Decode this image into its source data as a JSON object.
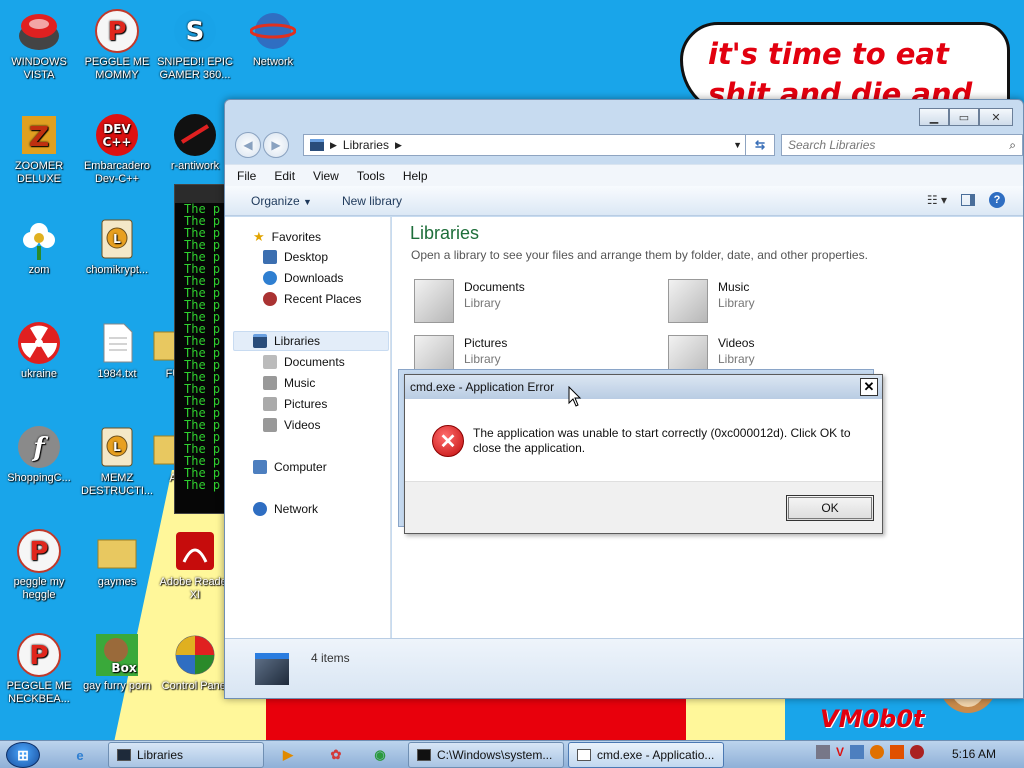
{
  "wallpaper": {
    "bubble_text": "it's time to eat shit and die and chew",
    "signature": "VM0b0t",
    "colors": {
      "sky": "#19a5ea",
      "paper": "#fff79a",
      "red": "#e8000c"
    }
  },
  "desktop_icons": [
    {
      "label": "WINDOWS VISTA",
      "icon": "orb-icon"
    },
    {
      "label": "PEGGLE ME MOMMY",
      "icon": "peggle-icon"
    },
    {
      "label": "SNIPED!! EPIC GAMER 360...",
      "icon": "skype-icon"
    },
    {
      "label": "Network",
      "icon": "network-icon"
    },
    {
      "label": "ZOOMER DELUXE",
      "icon": "zoomer-icon"
    },
    {
      "label": "Embarcadero Dev-C++",
      "icon": "devcpp-icon"
    },
    {
      "label": "r-antiwork",
      "icon": "reddit-icon"
    },
    {
      "label": "zom",
      "icon": "flower-icon"
    },
    {
      "label": "chomikrypt...",
      "icon": "lock-icon"
    },
    {
      "label": "ukraine",
      "icon": "radiation-icon"
    },
    {
      "label": "1984.txt",
      "icon": "text-file-icon"
    },
    {
      "label": "FU",
      "icon": "folder-icon"
    },
    {
      "label": "ShoppingC...",
      "icon": "flash-icon"
    },
    {
      "label": "MEMZ DESTRUCTI...",
      "icon": "lock-icon"
    },
    {
      "label": "A",
      "icon": "folder-icon"
    },
    {
      "label": "peggle my heggle",
      "icon": "peggle-icon"
    },
    {
      "label": "gaymes",
      "icon": "folder-icon"
    },
    {
      "label": "Adobe Reader XI",
      "icon": "pdf-icon"
    },
    {
      "label": "PEGGLE ME NECKBEA...",
      "icon": "peggle-icon"
    },
    {
      "label": "gay furry porn",
      "icon": "box-icon"
    },
    {
      "label": "Control Panel",
      "icon": "control-panel-icon"
    }
  ],
  "terminal": {
    "line_text": "The p",
    "line_count": 24
  },
  "explorer": {
    "address": {
      "root": "Libraries"
    },
    "search_placeholder": "Search Libraries",
    "menu": [
      "File",
      "Edit",
      "View",
      "Tools",
      "Help"
    ],
    "commands": {
      "organize": "Organize",
      "new_library": "New library"
    },
    "nav": {
      "favorites": "Favorites",
      "desktop": "Desktop",
      "downloads": "Downloads",
      "recent": "Recent Places",
      "libraries": "Libraries",
      "documents": "Documents",
      "music": "Music",
      "pictures": "Pictures",
      "videos": "Videos",
      "computer": "Computer",
      "network": "Network"
    },
    "content": {
      "title": "Libraries",
      "subtitle": "Open a library to see your files and arrange them by folder, date, and other properties.",
      "libraries": [
        {
          "name": "Documents",
          "type": "Library"
        },
        {
          "name": "Music",
          "type": "Library"
        },
        {
          "name": "Pictures",
          "type": "Library"
        },
        {
          "name": "Videos",
          "type": "Library"
        }
      ]
    },
    "status": {
      "count": "4 items"
    }
  },
  "dialog": {
    "title": "cmd.exe - Application Error",
    "message": "The application was unable to start correctly (0xc000012d). Click OK to close the application.",
    "ok_label": "OK"
  },
  "taskbar": {
    "tasks": [
      {
        "label": "Libraries"
      },
      {
        "label": "C:\\Windows\\system..."
      },
      {
        "label": "cmd.exe - Applicatio..."
      }
    ],
    "clock": "5:16 AM"
  }
}
